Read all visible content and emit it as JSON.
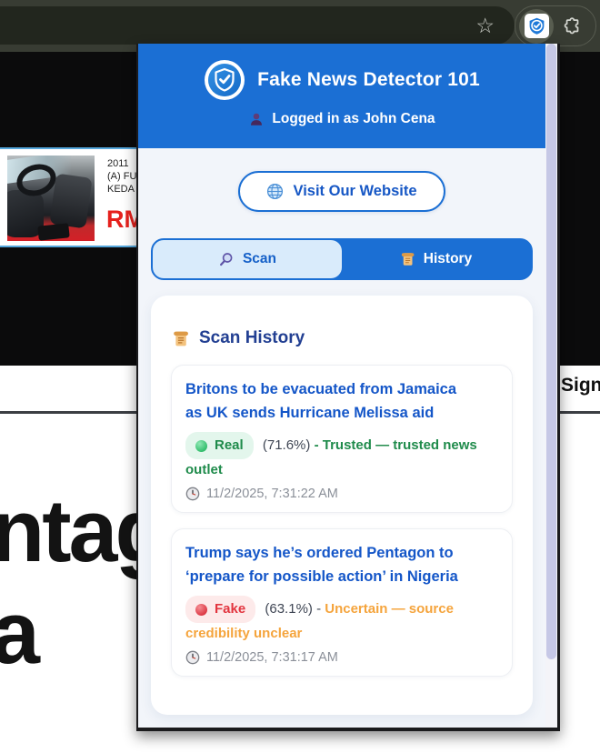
{
  "browser_chrome": {
    "bookmark_star_icon": "☆",
    "extension_shield_icon": "shield-check",
    "extensions_puzzle_icon": "puzzle-piece"
  },
  "background_page": {
    "car_listing": {
      "line1": "2011",
      "line2": "(A) FU",
      "line3": "KEDA",
      "price_prefix": "RM"
    },
    "sign_button_label": "Sign",
    "headline_line1": "ntago",
    "headline_line2": "a"
  },
  "popup": {
    "header": {
      "title": "Fake News Detector 101",
      "user_icon": "person-silhouette",
      "login_status": "Logged in as John Cena"
    },
    "website_button": {
      "icon": "globe",
      "label": "Visit Our Website"
    },
    "tabs": [
      {
        "label": "Scan",
        "icon": "magnifier",
        "active": false
      },
      {
        "label": "History",
        "icon": "scroll",
        "active": true
      }
    ],
    "history": {
      "section_icon": "scroll",
      "section_title": "Scan History",
      "items": [
        {
          "title": "Britons to be evacuated from Jamaica as UK sends Hurricane Melissa aid",
          "verdict": "Real",
          "verdict_color": "#1f8b4b",
          "confidence": "(71.6%)",
          "separator": "-",
          "source_note": "Trusted — trusted news outlet",
          "note_color": "#1f8b4b",
          "timestamp": "11/2/2025, 7:31:22 AM"
        },
        {
          "title": "Trump says he’s ordered Pentagon to ‘prepare for possible action’ in Nigeria",
          "verdict": "Fake",
          "verdict_color": "#e2353f",
          "confidence": "(63.1%)",
          "separator": "-",
          "source_note": "Uncertain — source credibility unclear",
          "note_color": "#f5a43c",
          "timestamp": "11/2/2025, 7:31:17 AM"
        }
      ]
    },
    "colors": {
      "header_blue": "#1b6fd4",
      "body_bg": "#f2f5fa",
      "scrollbar_thumb": "#c6c8e6"
    }
  }
}
